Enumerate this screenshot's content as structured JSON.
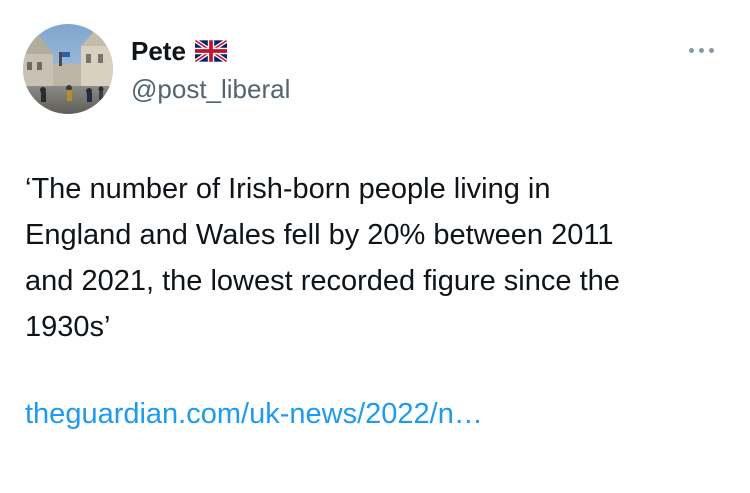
{
  "author": {
    "display_name": "Pete",
    "flag_icon": "uk-flag-icon",
    "handle": "@post_liberal",
    "avatar_icon": "profile-photo-street-scene"
  },
  "header": {
    "more_icon": "more-horizontal-icon"
  },
  "tweet": {
    "text_lines": [
      "‘The number of Irish-born people living in",
      "England and Wales fell by 20% between 2011",
      "and 2021, the lowest recorded figure since the",
      "1930s’"
    ],
    "link_text": "theguardian.com/uk-news/2022/n…"
  },
  "colors": {
    "text": "#0f1419",
    "secondary": "#536471",
    "link": "#1d9bf0"
  }
}
